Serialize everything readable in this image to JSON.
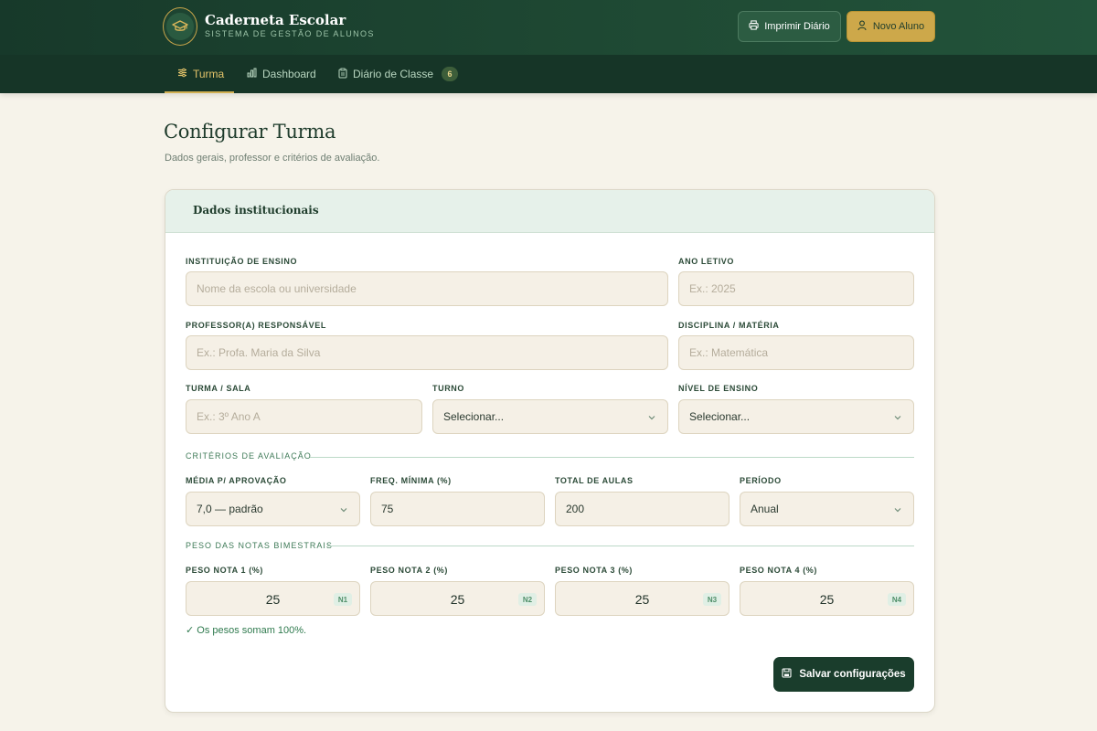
{
  "app": {
    "title": "Caderneta Escolar",
    "subtitle": "SISTEMA DE GESTÃO DE ALUNOS",
    "logo_icon": "graduation-cap-icon"
  },
  "header_actions": {
    "print_label": "Imprimir Diário",
    "print_icon": "printer-icon",
    "new_student_label": "Novo Aluno",
    "new_student_icon": "user-plus-icon"
  },
  "nav": {
    "items": [
      {
        "label": "Turma",
        "icon": "sliders-icon",
        "active": true
      },
      {
        "label": "Dashboard",
        "icon": "bar-chart-icon",
        "active": false
      },
      {
        "label": "Diário de Classe",
        "icon": "clipboard-icon",
        "active": false,
        "badge": "6"
      }
    ]
  },
  "page": {
    "title": "Configurar Turma",
    "subtitle": "Dados gerais, professor e critérios de avaliação."
  },
  "card": {
    "title": "Dados institucionais"
  },
  "fields": {
    "instituicao": {
      "label": "INSTITUIÇÃO DE ENSINO",
      "value": "",
      "placeholder": "Nome da escola ou universidade"
    },
    "ano_letivo": {
      "label": "ANO LETIVO",
      "value": "",
      "placeholder": "Ex.: 2025"
    },
    "professor": {
      "label": "PROFESSOR(A) RESPONSÁVEL",
      "value": "",
      "placeholder": "Ex.: Profa. Maria da Silva"
    },
    "disciplina": {
      "label": "DISCIPLINA / MATÉRIA",
      "value": "",
      "placeholder": "Ex.: Matemática"
    },
    "turma": {
      "label": "TURMA / SALA",
      "value": "",
      "placeholder": "Ex.: 3º Ano A"
    },
    "turno": {
      "label": "TURNO",
      "selected": "Selecionar..."
    },
    "nivel": {
      "label": "NÍVEL DE ENSINO",
      "selected": "Selecionar..."
    }
  },
  "criteria": {
    "section_title": "CRITÉRIOS DE AVALIAÇÃO",
    "media": {
      "label": "MÉDIA P/ APROVAÇÃO",
      "selected": "7,0 — padrão"
    },
    "freq": {
      "label": "FREQ. MÍNIMA (%)",
      "value": "75"
    },
    "total_aulas": {
      "label": "TOTAL DE AULAS",
      "value": "200"
    },
    "periodo": {
      "label": "PERÍODO",
      "selected": "Anual"
    }
  },
  "weights": {
    "section_title": "PESO DAS NOTAS BIMESTRAIS",
    "items": [
      {
        "label": "PESO NOTA 1 (%)",
        "value": "25",
        "tag": "N1"
      },
      {
        "label": "PESO NOTA 2 (%)",
        "value": "25",
        "tag": "N2"
      },
      {
        "label": "PESO NOTA 3 (%)",
        "value": "25",
        "tag": "N3"
      },
      {
        "label": "PESO NOTA 4 (%)",
        "value": "25",
        "tag": "N4"
      }
    ],
    "sum_note": "✓ Os pesos somam 100%."
  },
  "actions": {
    "save_label": "Salvar configurações",
    "save_icon": "save-icon"
  },
  "colors": {
    "header_dark": "#17392a",
    "accent_gold": "#cda84a",
    "background": "#f6f3ea",
    "card_header": "#e6f1ea",
    "success_green": "#2f7a4e"
  }
}
